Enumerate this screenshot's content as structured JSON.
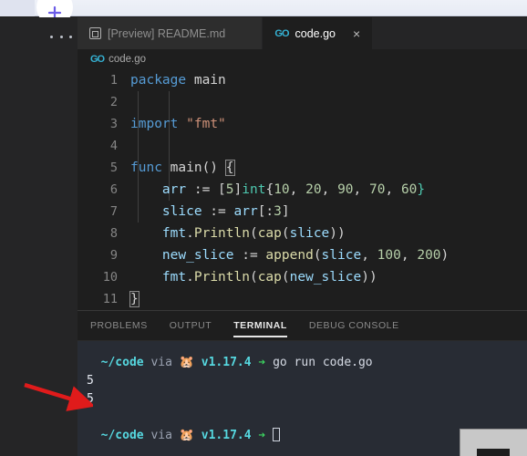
{
  "browser": {
    "new_tab_icon": "plus-icon",
    "accent": "#6b5ce7"
  },
  "window": {
    "app": "Visual Studio Code",
    "theme_bg": "#1e1e1e",
    "terminal_bg": "#282c34"
  },
  "tabbar": {
    "overflow_label": "...",
    "tabs": [
      {
        "label": "[Preview] README.md",
        "icon": "markdown-preview-icon",
        "active": false,
        "close_label": "×"
      },
      {
        "label": "code.go",
        "icon": "go-file-icon",
        "active": true,
        "close_label": "×"
      }
    ]
  },
  "breadcrumb": {
    "icon": "go-file-icon",
    "path": "code.go"
  },
  "editor": {
    "language": "go",
    "line_numbers": [
      "1",
      "2",
      "3",
      "4",
      "5",
      "6",
      "7",
      "8",
      "9",
      "10",
      "11"
    ],
    "lines": [
      "package main",
      "",
      "import \"fmt\"",
      "",
      "func main() {",
      "    arr := [5]int{10, 20, 90, 70, 60}",
      "    slice := arr[:3]",
      "    fmt.Println(cap(slice))",
      "    new_slice := append(slice, 100, 200)",
      "    fmt.Println(cap(new_slice))",
      "}"
    ],
    "tokens": {
      "l1_kw": "package",
      "l1_name": "main",
      "l3_kw": "import",
      "l3_str": "\"fmt\"",
      "l5_kw": "func",
      "l5_name": "main",
      "l5_paren": "()",
      "l5_brace": "{",
      "l6_var": "arr",
      "l6_assign": " := ",
      "l6_bracket": "[",
      "l6_size": "5",
      "l6_bracket2": "]",
      "l6_type": "int",
      "l6_open": "{",
      "l6_n1": "10",
      "l6_c1": ", ",
      "l6_n2": "20",
      "l6_c2": ", ",
      "l6_n3": "90",
      "l6_c3": ", ",
      "l6_n4": "70",
      "l6_c4": ", ",
      "l6_n5": "60",
      "l6_close": "}",
      "l7_var": "slice",
      "l7_assign": " := ",
      "l7_src": "arr",
      "l7_slice": "[:",
      "l7_n": "3",
      "l7_end": "]",
      "l8_pkg": "fmt",
      "l8_dot": ".",
      "l8_fn": "Println",
      "l8_o1": "(",
      "l8_fn2": "cap",
      "l8_o2": "(",
      "l8_arg": "slice",
      "l8_c": "))",
      "l9_var": "new_slice",
      "l9_assign": " := ",
      "l9_fn": "append",
      "l9_o": "(",
      "l9_a1": "slice",
      "l9_c1": ", ",
      "l9_n1": "100",
      "l9_c2": ", ",
      "l9_n2": "200",
      "l9_close": ")",
      "l10_pkg": "fmt",
      "l10_dot": ".",
      "l10_fn": "Println",
      "l10_o1": "(",
      "l10_fn2": "cap",
      "l10_o2": "(",
      "l10_arg": "new_slice",
      "l10_c": "))",
      "l11_brace": "}"
    },
    "colors": {
      "keyword": "#569cd6",
      "string": "#ce9178",
      "number": "#b5cea8",
      "function": "#dcdcaa",
      "variable": "#9cdcfe",
      "type": "#4ec9b0",
      "plain": "#d4d4d4"
    }
  },
  "panel": {
    "tabs": [
      {
        "label": "PROBLEMS",
        "active": false
      },
      {
        "label": "OUTPUT",
        "active": false
      },
      {
        "label": "TERMINAL",
        "active": true
      },
      {
        "label": "DEBUG CONSOLE",
        "active": false
      }
    ]
  },
  "terminal": {
    "prompt": {
      "path": "~/code",
      "via": "via",
      "runtime_icon": "gopher-icon",
      "version": "v1.17.4",
      "arrow": "➔"
    },
    "command": "go run code.go",
    "output": [
      "5",
      "5"
    ],
    "cursor": "block-cursor",
    "colors": {
      "path": "#56d8e0",
      "version": "#56d8e0",
      "arrow": "#3ddc62",
      "output": "#e6eaf2"
    }
  },
  "annotation": {
    "arrow_color": "#e01b1b",
    "points_to": "first-output-line"
  }
}
